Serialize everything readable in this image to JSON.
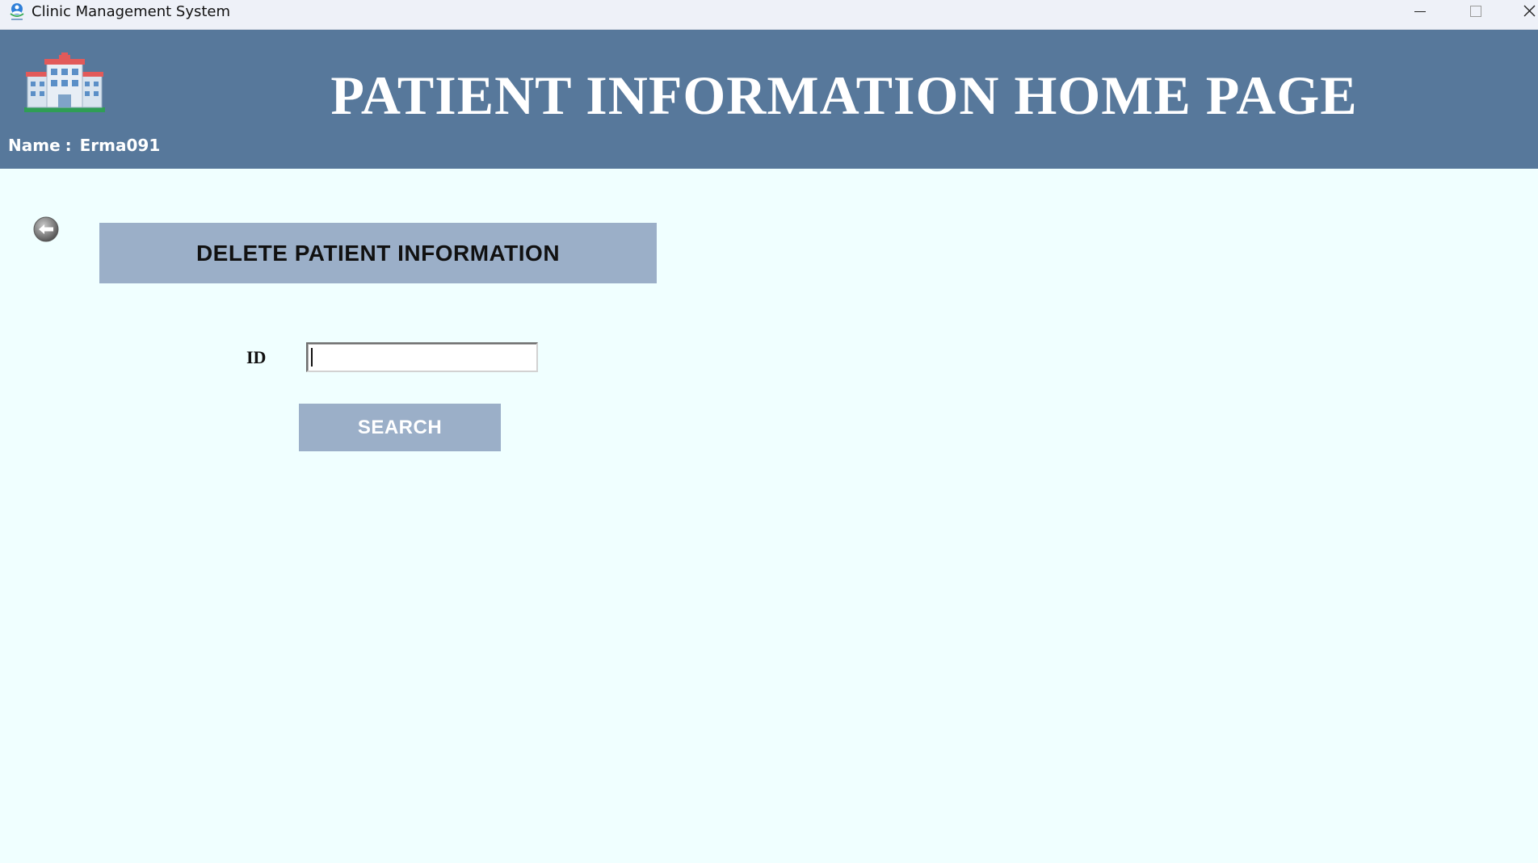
{
  "window": {
    "title": "Clinic Management System",
    "app_icon": "clinic-app-icon",
    "controls": {
      "minimize": "minimize-icon",
      "maximize": "maximize-icon",
      "close": "close-icon"
    }
  },
  "header": {
    "title": "PATIENT INFORMATION HOME PAGE",
    "logo_icon": "hospital-icon",
    "user_label": "Name",
    "user_separator": ":",
    "username": "Erma091",
    "background_color": "#57789b"
  },
  "main": {
    "back_icon": "back-arrow-icon",
    "section_title": "DELETE PATIENT INFORMATION",
    "id_field": {
      "label": "ID",
      "value": "",
      "placeholder": ""
    },
    "search_button_label": "SEARCH",
    "accent_color": "#9bafc8",
    "background_color": "#f0ffff"
  }
}
